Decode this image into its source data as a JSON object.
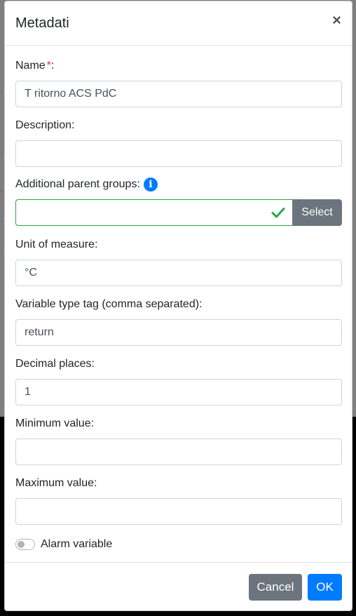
{
  "modal": {
    "title": "Metadati",
    "close_symbol": "×"
  },
  "fields": {
    "name": {
      "label": "Name",
      "required_mark": "*",
      "label_suffix": ":",
      "value": "T ritorno ACS PdC"
    },
    "description": {
      "label": "Description:",
      "value": ""
    },
    "parent_groups": {
      "label": "Additional parent groups:",
      "info_icon": "info-icon",
      "value": "",
      "select_label": "Select",
      "valid_icon": "check-icon"
    },
    "unit": {
      "label": "Unit of measure:",
      "value": "°C"
    },
    "type_tag": {
      "label": "Variable type tag (comma separated):",
      "value": "return"
    },
    "decimals": {
      "label": "Decimal places:",
      "value": "1"
    },
    "min": {
      "label": "Minimum value:",
      "value": ""
    },
    "max": {
      "label": "Maximum value:",
      "value": ""
    }
  },
  "alarm": {
    "label": "Alarm variable",
    "checked": false
  },
  "footer": {
    "cancel_label": "Cancel",
    "ok_label": "OK"
  },
  "colors": {
    "primary": "#007bff",
    "secondary": "#6c757d",
    "success": "#28a745",
    "danger": "#dc3545"
  }
}
